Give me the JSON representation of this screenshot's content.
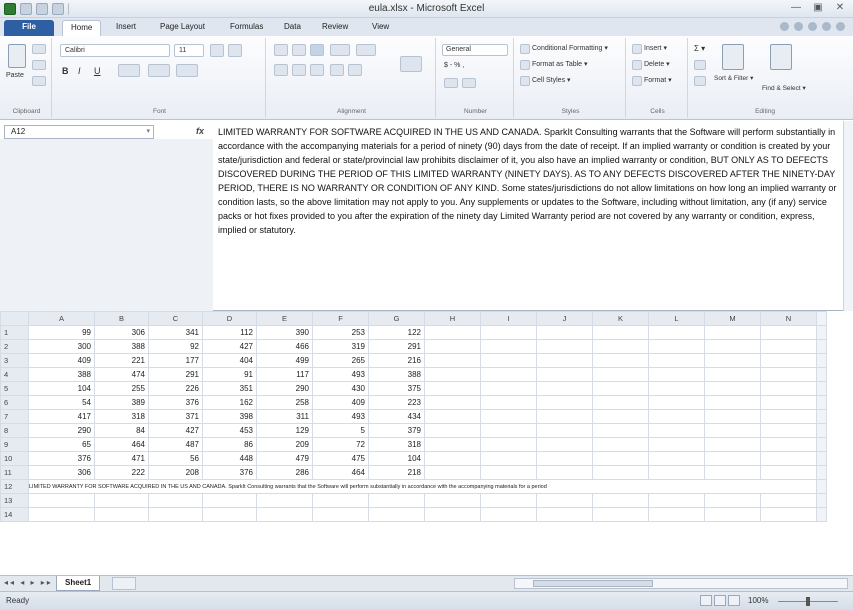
{
  "window": {
    "title": "eula.xlsx - Microsoft Excel",
    "controls": [
      "—",
      "▣",
      "✕"
    ]
  },
  "tabs": {
    "file": "File",
    "items": [
      "Home",
      "Insert",
      "Page Layout",
      "Formulas",
      "Data",
      "Review",
      "View"
    ],
    "active": "Home"
  },
  "ribbon": {
    "clipboard": {
      "paste": "Paste",
      "label": "Clipboard"
    },
    "font": {
      "name": "Calibri",
      "size": "11",
      "label": "Font",
      "bold": "B",
      "italic": "I",
      "underline": "U"
    },
    "alignment": {
      "label": "Alignment"
    },
    "number": {
      "format": "General",
      "currency": "$ - % ,",
      "label": "Number"
    },
    "styles": {
      "conditional": "Conditional Formatting ▾",
      "table": "Format as Table ▾",
      "cell": "Cell Styles ▾",
      "label": "Styles"
    },
    "cells": {
      "insert": "Insert ▾",
      "delete": "Delete ▾",
      "format": "Format ▾",
      "label": "Cells"
    },
    "editing": {
      "sigma": "Σ ▾",
      "sort": "Sort & Filter ▾",
      "find": "Find & Select ▾",
      "label": "Editing"
    }
  },
  "formula_bar": {
    "name_box": "A12",
    "fx": "fx",
    "content": "LIMITED WARRANTY FOR SOFTWARE ACQUIRED IN THE US AND CANADA. SparkIt Consulting warrants that the Software will perform substantially in accordance with the accompanying materials for a period of ninety (90) days from the date of receipt. If an implied warranty or condition is created by your state/jurisdiction and federal or state/provincial law prohibits disclaimer of it, you also have an implied warranty or condition, BUT ONLY AS TO DEFECTS DISCOVERED DURING THE PERIOD OF THIS LIMITED WARRANTY (NINETY DAYS). AS TO ANY DEFECTS DISCOVERED AFTER THE NINETY-DAY PERIOD, THERE IS NO WARRANTY OR CONDITION OF ANY KIND. Some states/jurisdictions do not allow limitations on how long an implied warranty or condition lasts, so the above limitation may not apply to you. Any supplements or updates to the Software, including without limitation, any (if any) service packs or hot fixes provided to you after the expiration of the ninety day Limited Warranty period are not covered by any warranty or condition, express, implied or statutory."
  },
  "sheet": {
    "columns": [
      "A",
      "B",
      "C",
      "D",
      "E",
      "F",
      "G",
      "H",
      "I",
      "J",
      "K",
      "L",
      "M",
      "N"
    ],
    "rows": [
      [
        "1",
        "99",
        "306",
        "341",
        "112",
        "390",
        "253",
        "122"
      ],
      [
        "2",
        "300",
        "388",
        "92",
        "427",
        "466",
        "319",
        "291"
      ],
      [
        "3",
        "409",
        "221",
        "177",
        "404",
        "499",
        "265",
        "216"
      ],
      [
        "4",
        "388",
        "474",
        "291",
        "91",
        "117",
        "493",
        "388"
      ],
      [
        "5",
        "104",
        "255",
        "226",
        "351",
        "290",
        "430",
        "375"
      ],
      [
        "6",
        "54",
        "389",
        "376",
        "162",
        "258",
        "409",
        "223"
      ],
      [
        "7",
        "417",
        "318",
        "371",
        "398",
        "311",
        "493",
        "434"
      ],
      [
        "8",
        "290",
        "84",
        "427",
        "453",
        "129",
        "5",
        "379"
      ],
      [
        "9",
        "65",
        "464",
        "487",
        "86",
        "209",
        "72",
        "318"
      ],
      [
        "10",
        "376",
        "471",
        "56",
        "448",
        "479",
        "475",
        "104"
      ],
      [
        "11",
        "306",
        "222",
        "208",
        "376",
        "286",
        "464",
        "218"
      ]
    ],
    "row12_label": "12",
    "row12_text": "LIMITED WARRANTY FOR SOFTWARE ACQUIRED IN THE US AND CANADA. SparkIt Consulting warrants that the Software will perform substantially in accordance with the accompanying materials for a period",
    "extra_rows": [
      "13",
      "14"
    ]
  },
  "sheet_tabs": {
    "nav": "◂◂ ◂ ▸ ▸▸",
    "active": "Sheet1"
  },
  "status": {
    "ready": "Ready",
    "zoom": "100%"
  }
}
